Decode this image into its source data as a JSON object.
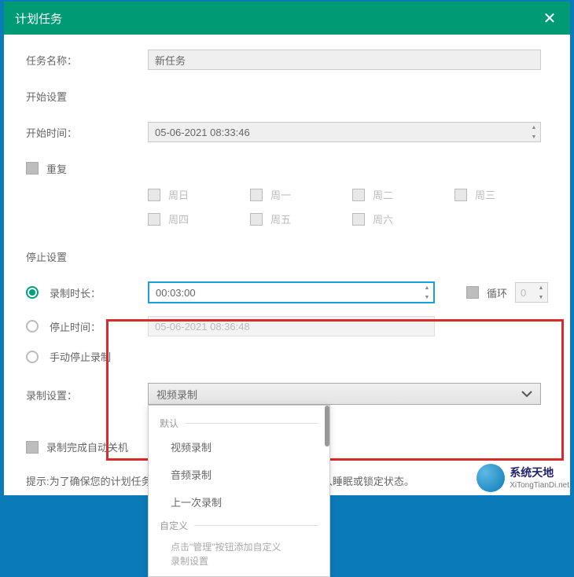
{
  "titlebar": {
    "title": "计划任务"
  },
  "task_name": {
    "label": "任务名称：",
    "value": "新任务"
  },
  "start_section": {
    "header": "开始设置",
    "time_label": "开始时间：",
    "time_value": "05-06-2021 08:33:46",
    "repeat_label": "重复"
  },
  "days": {
    "sun": "周日",
    "mon": "周一",
    "tue": "周二",
    "wed": "周三",
    "thu": "周四",
    "fri": "周五",
    "sat": "周六"
  },
  "stop_section": {
    "header": "停止设置",
    "duration_label": "录制时长：",
    "duration_value": "00:03:00",
    "stoptime_label": "停止时间：",
    "stoptime_value": "05-06-2021 08:36:48",
    "manual_label": "手动停止录制",
    "loop_label": "循环",
    "loop_value": "0"
  },
  "record_section": {
    "header": "录制设置：",
    "selected": "视频录制",
    "group_default": "默认",
    "options": {
      "video": "视频录制",
      "audio": "音频录制",
      "last": "上一次录制"
    },
    "group_custom": "自定义",
    "custom_hint": "点击\"管理\"按钮添加自定义",
    "custom_hint2": "录制设置"
  },
  "auto_shutdown": {
    "label": "录制完成自动关机"
  },
  "tip": {
    "prefix": "提示:为了确保您的计划任务",
    "suffix": "入睡眠或锁定状态。"
  },
  "watermark": {
    "line1": "系统天地",
    "line2": "XiTongTianDi.net"
  }
}
